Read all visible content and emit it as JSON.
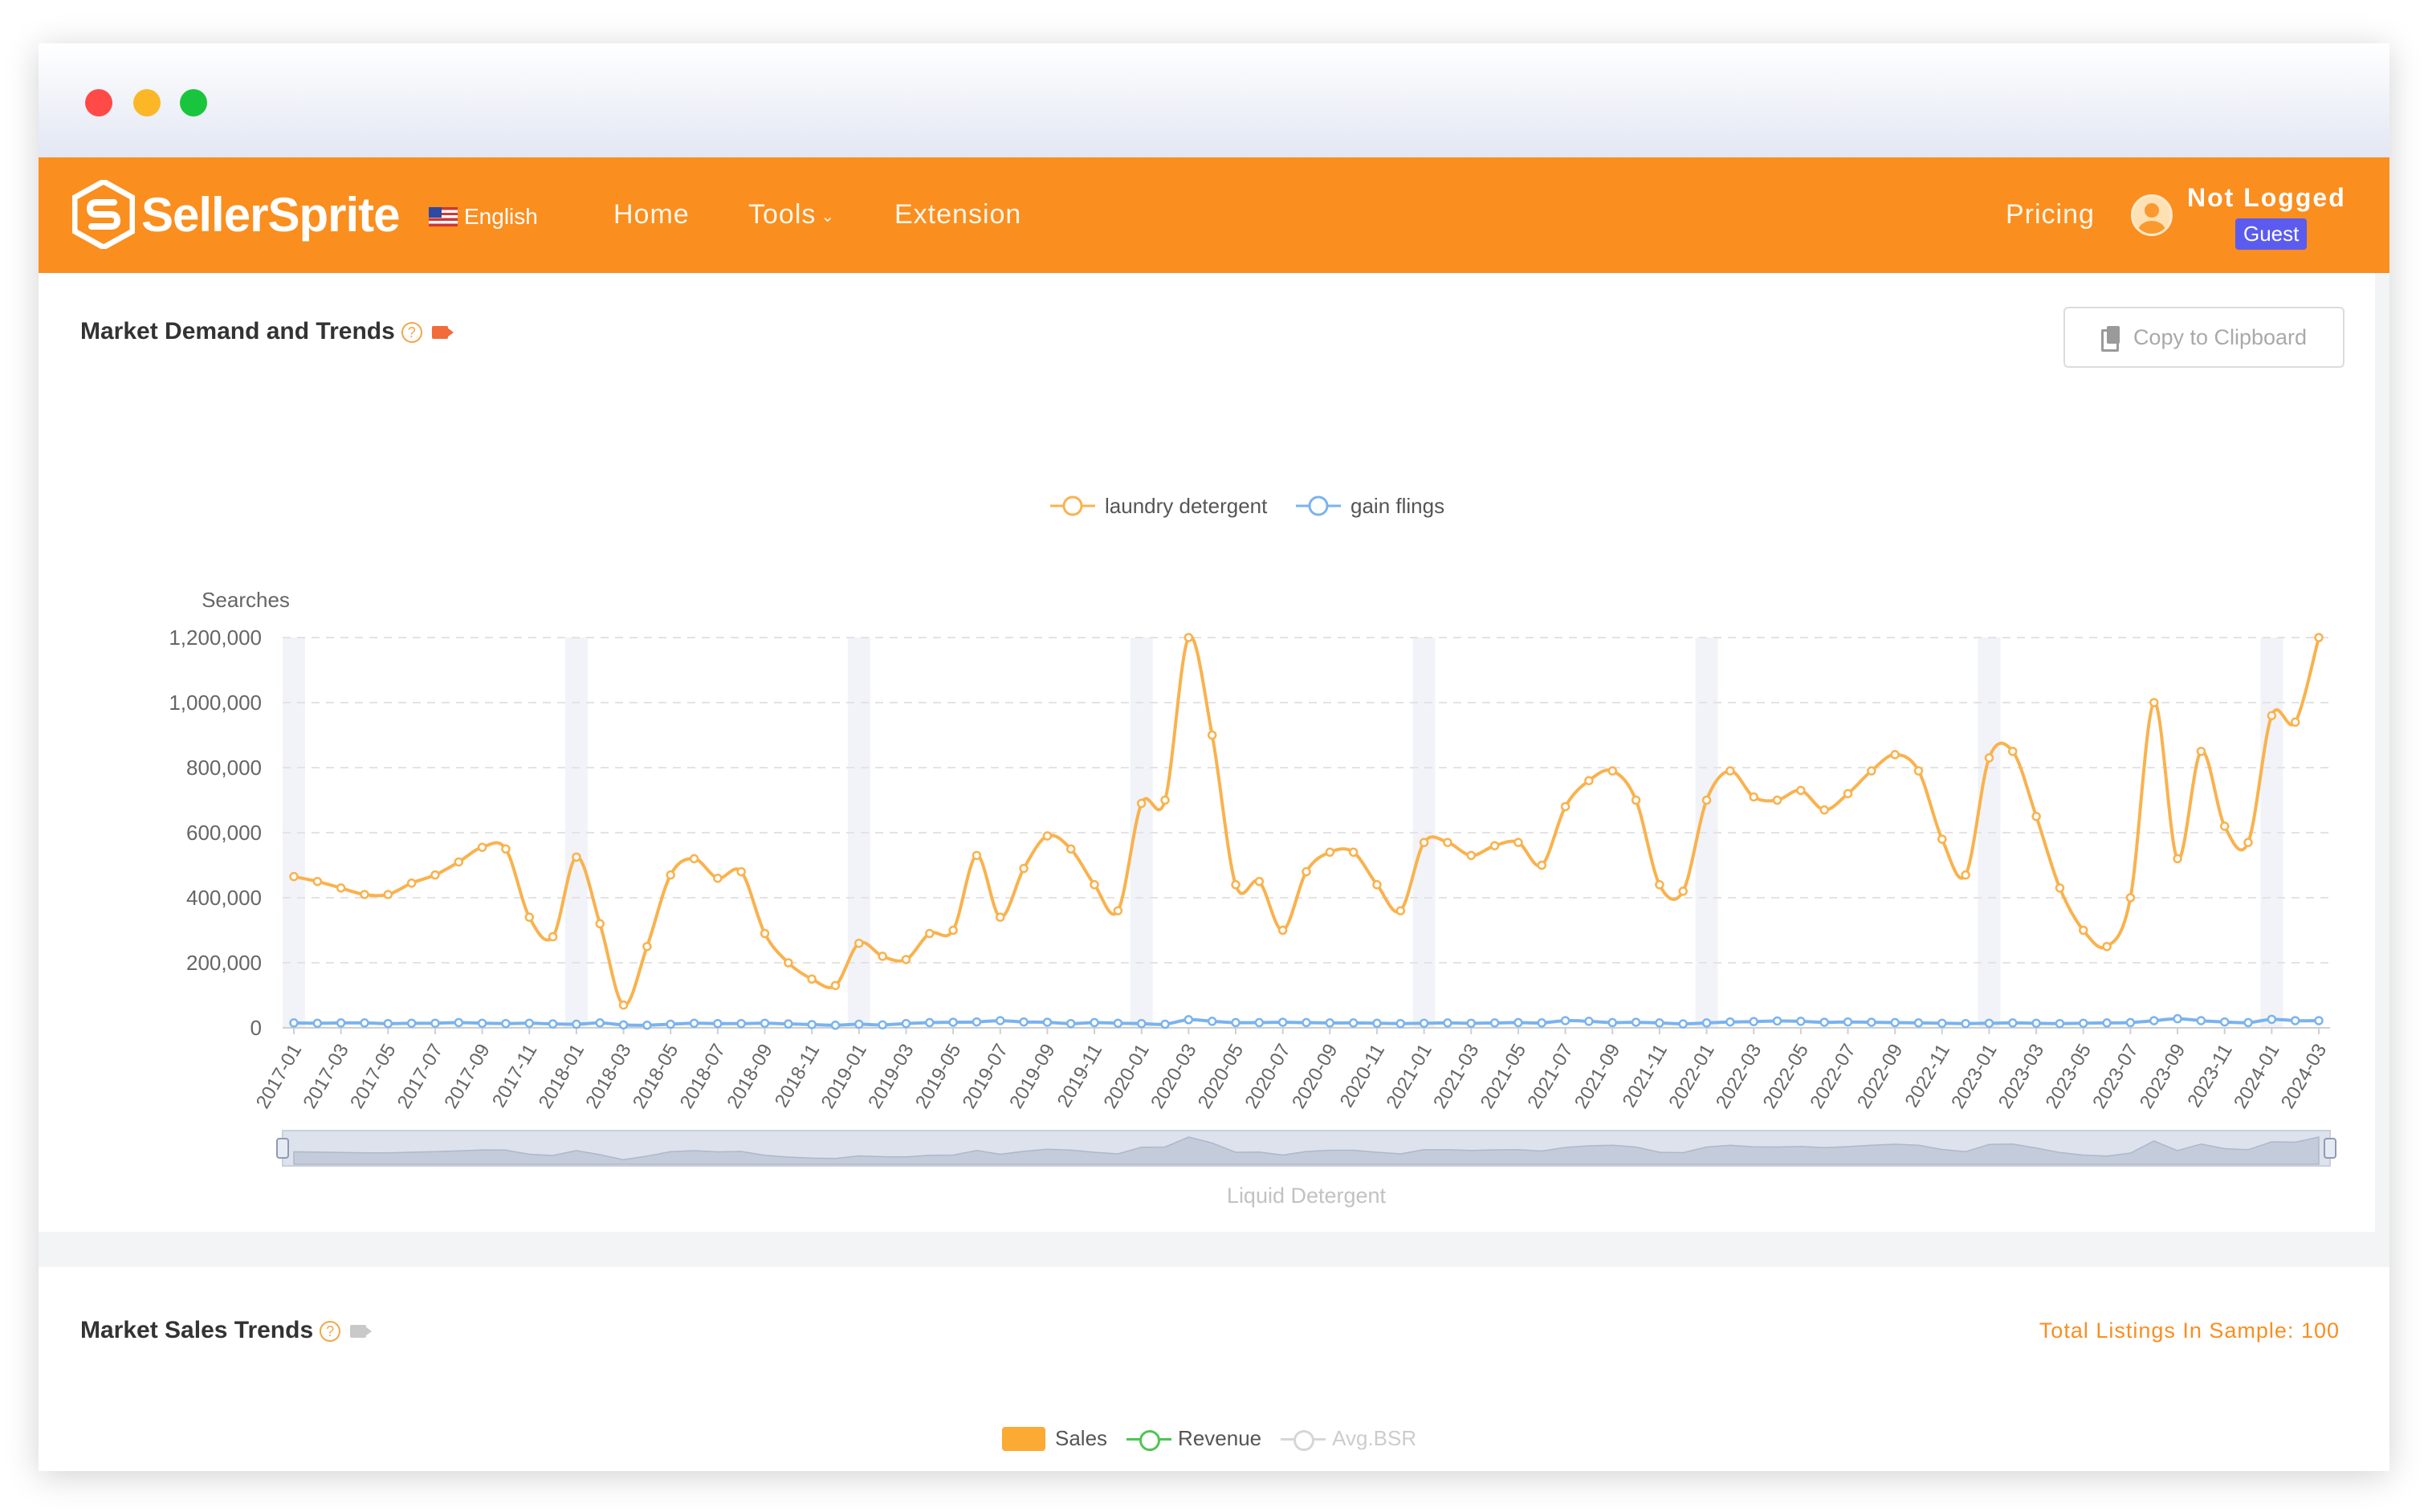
{
  "app": {
    "brand": "SellerSprite",
    "language": "English",
    "nav": {
      "home": "Home",
      "tools": "Tools",
      "extension": "Extension",
      "pricing": "Pricing"
    },
    "user": {
      "name": "Not Logged",
      "badge": "Guest"
    },
    "colors": {
      "brand_orange": "#fa8e1f",
      "badge_blue": "#5b5bf0"
    }
  },
  "demand_section": {
    "title": "Market Demand and Trends",
    "copy_label": "Copy to Clipboard",
    "icons": [
      "question-circle-icon",
      "video-camera-icon",
      "copy-icon"
    ]
  },
  "sales_section": {
    "title": "Market Sales Trends",
    "sample_text": "Total Listings In Sample: 100",
    "legend": {
      "sales": "Sales",
      "revenue": "Revenue",
      "avg_bsr": "Avg.BSR"
    }
  },
  "chart_data": {
    "type": "line",
    "ylabel": "Searches",
    "ylim": [
      0,
      1200000
    ],
    "y_ticks": [
      "0",
      "200,000",
      "400,000",
      "600,000",
      "800,000",
      "1,000,000",
      "1,200,000"
    ],
    "x_tick_labels": [
      "2017-01",
      "2017-03",
      "2017-05",
      "2017-07",
      "2017-09",
      "2017-11",
      "2018-01",
      "2018-03",
      "2018-05",
      "2018-07",
      "2018-09",
      "2018-11",
      "2019-01",
      "2019-03",
      "2019-05",
      "2019-07",
      "2019-09",
      "2019-11",
      "2020-01",
      "2020-03",
      "2020-05",
      "2020-07",
      "2020-09",
      "2020-11",
      "2021-01",
      "2021-03",
      "2021-05",
      "2021-07",
      "2021-09",
      "2021-11",
      "2022-01",
      "2022-03",
      "2022-05",
      "2022-07",
      "2022-09",
      "2022-11",
      "2023-01",
      "2023-03",
      "2023-05",
      "2023-07",
      "2023-09",
      "2023-11",
      "2024-01",
      "2024-03"
    ],
    "grid": true,
    "legend_position": "top-center",
    "zoom_caption": "Liquid Detergent",
    "series": [
      {
        "name": "laundry detergent",
        "color": "#f9b24e",
        "values": [
          465000,
          450000,
          430000,
          410000,
          410000,
          445000,
          470000,
          510000,
          555000,
          550000,
          340000,
          280000,
          525000,
          320000,
          70000,
          250000,
          470000,
          520000,
          460000,
          480000,
          290000,
          200000,
          150000,
          130000,
          260000,
          220000,
          210000,
          290000,
          300000,
          530000,
          340000,
          490000,
          590000,
          550000,
          440000,
          360000,
          690000,
          700000,
          1200000,
          900000,
          440000,
          450000,
          300000,
          480000,
          540000,
          540000,
          440000,
          360000,
          570000,
          570000,
          530000,
          560000,
          570000,
          500000,
          680000,
          760000,
          790000,
          700000,
          440000,
          420000,
          700000,
          790000,
          710000,
          700000,
          730000,
          670000,
          720000,
          790000,
          840000,
          790000,
          580000,
          470000,
          830000,
          850000,
          650000,
          430000,
          300000,
          250000,
          400000,
          1000000,
          520000,
          850000,
          620000,
          570000,
          960000,
          940000,
          1200000
        ]
      },
      {
        "name": "gain flings",
        "color": "#7ab3ef",
        "values": [
          15000,
          14000,
          15000,
          15000,
          13000,
          14000,
          14000,
          16000,
          14000,
          13000,
          14000,
          12000,
          11000,
          15000,
          9000,
          8000,
          11000,
          14000,
          13000,
          13000,
          14000,
          12000,
          10000,
          8000,
          11000,
          9000,
          13000,
          16000,
          17000,
          18000,
          22000,
          18000,
          17000,
          13000,
          16000,
          14000,
          13000,
          11000,
          25000,
          20000,
          16000,
          16000,
          17000,
          16000,
          15000,
          15000,
          14000,
          13000,
          14000,
          15000,
          14000,
          15000,
          16000,
          15000,
          22000,
          20000,
          16000,
          17000,
          15000,
          12000,
          15000,
          18000,
          19000,
          21000,
          20000,
          17000,
          18000,
          17000,
          16000,
          15000,
          14000,
          13000,
          14000,
          15000,
          14000,
          13000,
          14000,
          15000,
          16000,
          22000,
          28000,
          22000,
          18000,
          16000,
          26000,
          22000,
          22000
        ]
      }
    ]
  }
}
